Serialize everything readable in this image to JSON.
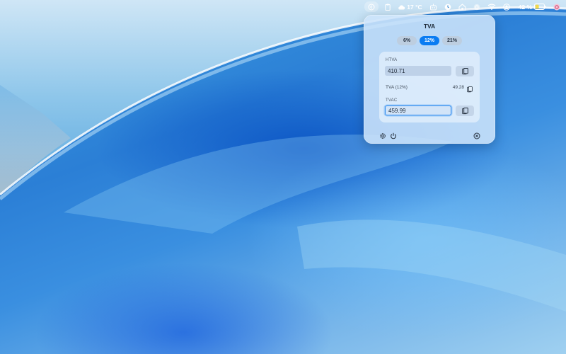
{
  "menubar": {
    "temperature": "17 °C",
    "battery_percent": "42 %",
    "battery_level": 0.42,
    "icons": [
      "app-status-icon",
      "clipboard-icon",
      "weather-cloud-icon",
      "robot-icon",
      "clock-icon",
      "home-icon",
      "airdrop-icon",
      "wifi-icon",
      "user-icon",
      "battery-icon",
      "profile-icon"
    ]
  },
  "panel": {
    "title": "TVA",
    "rates": [
      "6%",
      "12%",
      "21%"
    ],
    "active_rate": "12%",
    "htva_label": "HTVA",
    "htva_value": "410.71",
    "tva_label": "TVA (12%)",
    "tva_value": "49.28",
    "tvac_label": "TVAC",
    "tvac_value": "459.99",
    "icons": [
      "copy-icon",
      "gear-icon",
      "power-icon",
      "close-icon"
    ]
  },
  "colors": {
    "accent": "#0a7cf2",
    "panel_bg": "#cde4fa",
    "text_dark": "#1e2a38"
  }
}
